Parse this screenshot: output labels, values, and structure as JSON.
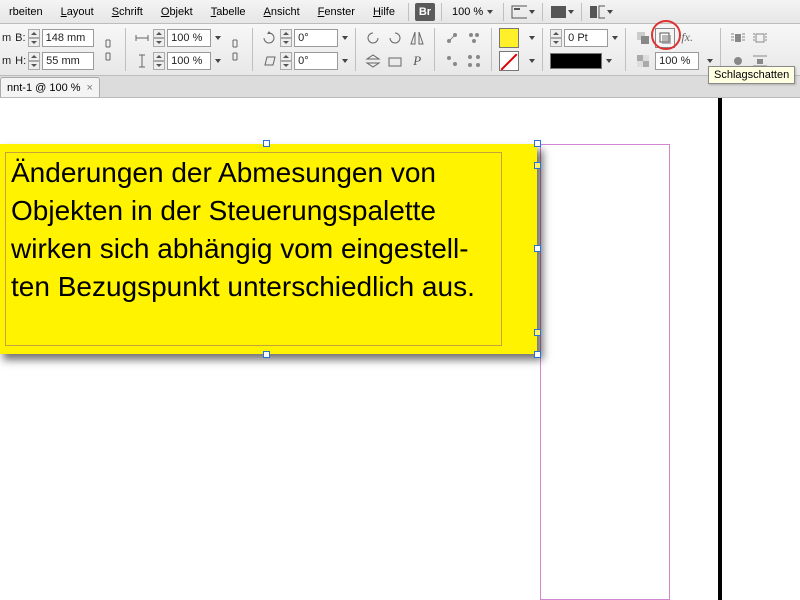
{
  "menu": {
    "items": [
      {
        "pre": "",
        "ul": "",
        "post": "rbeiten"
      },
      {
        "pre": "",
        "ul": "L",
        "post": "ayout"
      },
      {
        "pre": "",
        "ul": "S",
        "post": "chrift"
      },
      {
        "pre": "",
        "ul": "O",
        "post": "bjekt"
      },
      {
        "pre": "",
        "ul": "T",
        "post": "abelle"
      },
      {
        "pre": "",
        "ul": "A",
        "post": "nsicht"
      },
      {
        "pre": "",
        "ul": "F",
        "post": "enster"
      },
      {
        "pre": "",
        "ul": "H",
        "post": "ilfe"
      }
    ],
    "bridge_label": "Br",
    "zoom": "100 %"
  },
  "control": {
    "unit_top": "m",
    "unit_bot": "m",
    "width_label": "B:",
    "height_label": "H:",
    "width_value": "148 mm",
    "height_value": "55 mm",
    "scale_x": "100 %",
    "scale_y": "100 %",
    "rotate": "0°",
    "shear": "0°",
    "stroke_weight": "0 Pt",
    "opacity": "100 %"
  },
  "tab": {
    "title": "nnt-1 @ 100 %",
    "close": "×"
  },
  "textframe": {
    "content": "Änderungen der Abmesungen von Objekten in der Steuerungspalette wirken sich abhängig vom eingestell-\nten Bezugspunkt unterschiedlich aus."
  },
  "tooltip": {
    "text": "Schlagschatten"
  }
}
